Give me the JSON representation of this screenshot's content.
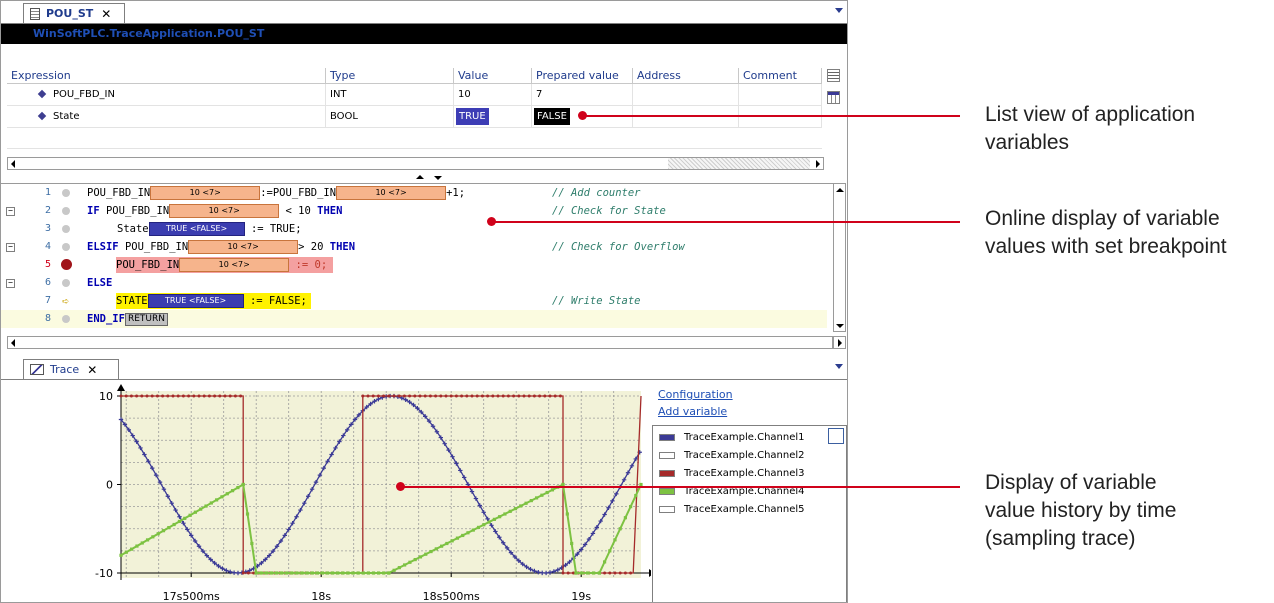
{
  "editor": {
    "tab_label": "POU_ST",
    "tab_close": "✕",
    "path_bar": "WinSoftPLC.TraceApplication.POU_ST"
  },
  "var_table": {
    "columns": [
      "Expression",
      "Type",
      "Value",
      "Prepared value",
      "Address",
      "Comment"
    ],
    "rows": [
      {
        "expression": "POU_FBD_IN",
        "type": "INT",
        "value": "10",
        "prepared": "7"
      },
      {
        "expression": "State",
        "type": "BOOL",
        "value": "TRUE",
        "prepared": "FALSE"
      }
    ]
  },
  "code": {
    "lines": [
      {
        "num": "1"
      },
      {
        "num": "2"
      },
      {
        "num": "3"
      },
      {
        "num": "4"
      },
      {
        "num": "5"
      },
      {
        "num": "6"
      },
      {
        "num": "7"
      },
      {
        "num": "8"
      }
    ],
    "tokens": {
      "pou": "POU_FBD_IN",
      "assign_pou": ":=POU_FBD_IN",
      "plus1": "+1;",
      "if": "IF",
      "lt10": "< 10",
      "then": "THEN",
      "state": "State",
      "assign_true": ":= TRUE;",
      "elsif": "ELSIF",
      "gt20": "> 20",
      "assign_0": ":= 0;",
      "else": "ELSE",
      "state_caps": "STATE",
      "assign_false": ":= FALSE;",
      "end_if": "END_IF",
      "return": "RETURN",
      "val_int": "10 <7>",
      "val_bool": "TRUE <FALSE>"
    },
    "comments": {
      "c1": "// Add counter",
      "c2": "// Check for State",
      "c4": "// Check for Overflow",
      "c7": "// Write State"
    }
  },
  "trace": {
    "tab_label": "Trace",
    "tab_close": "✕",
    "links": {
      "configuration": "Configuration",
      "add_variable": "Add variable"
    },
    "legend": [
      {
        "name": "TraceExample.Channel1",
        "color": "#3b3a96"
      },
      {
        "name": "TraceExample.Channel2",
        "color": "#ffffff"
      },
      {
        "name": "TraceExample.Channel3",
        "color": "#a52a2a"
      },
      {
        "name": "TraceExample.Channel4",
        "color": "#7dc242"
      },
      {
        "name": "TraceExample.Channel5",
        "color": "#ffffff"
      }
    ]
  },
  "chart_data": {
    "type": "line",
    "title": "",
    "xlabel": "",
    "ylabel": "",
    "x_ticks": [
      "17s500ms",
      "18s",
      "18s500ms",
      "19s"
    ],
    "x_tick_seconds": [
      17.5,
      18.0,
      18.5,
      19.0
    ],
    "y_ticks": [
      10,
      0,
      -10
    ],
    "ylim": [
      -11,
      10.5
    ],
    "xlim": [
      17.23,
      19.23
    ],
    "grid": true,
    "legend_position": "right",
    "series": [
      {
        "name": "TraceExample.Channel1",
        "color": "#3b3a96",
        "shape": "sine",
        "amplitude": 10,
        "period_s": 1.18,
        "phase_peak_s": 18.27
      },
      {
        "name": "TraceExample.Channel3",
        "color": "#a52a2a",
        "shape": "square",
        "high": 10,
        "low": -10,
        "edges_s": [
          17.23,
          17.7,
          18.16,
          18.93,
          19.2
        ],
        "start_level": "high"
      },
      {
        "name": "TraceExample.Channel4",
        "color": "#7dc242",
        "shape": "sawtooth",
        "high": 0,
        "low": -10,
        "start": -8,
        "peaks_s": [
          17.7,
          18.93
        ],
        "ramp_starts_s": [
          18.26,
          19.07
        ]
      }
    ]
  },
  "annotations": [
    {
      "lines": [
        "List view of application",
        "variables"
      ]
    },
    {
      "lines": [
        "Online display of variable",
        "values with set breakpoint"
      ]
    },
    {
      "lines": [
        "Display of variable",
        "value history by time",
        "(sampling trace)"
      ]
    }
  ],
  "colors": {
    "accent_red": "#d0021b",
    "header_blue": "#1f3b8c",
    "plot_bg": "#f2f2d8"
  }
}
